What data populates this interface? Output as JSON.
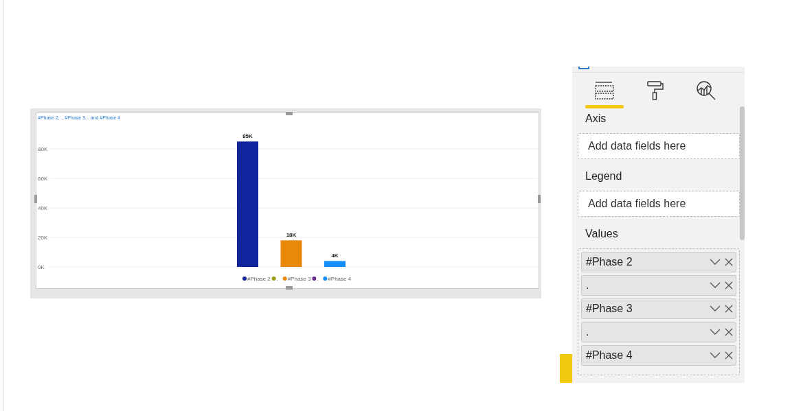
{
  "chart": {
    "chart_data": {
      "type": "bar",
      "title": "#Phase 2, ., #Phase 3, . and #Phase 4",
      "series": [
        {
          "name": "#Phase 2",
          "color": "#12239e",
          "values": [
            85000
          ]
        },
        {
          "name": ".",
          "color": "#9c9c12",
          "values": [
            null
          ]
        },
        {
          "name": "#Phase 3",
          "color": "#e8890c",
          "values": [
            18000
          ]
        },
        {
          "name": ".",
          "color": "#6b2d8f",
          "values": [
            null
          ]
        },
        {
          "name": "#Phase 4",
          "color": "#118dff",
          "values": [
            4000
          ]
        }
      ],
      "yticks": [
        {
          "value": 0,
          "label": "0K"
        },
        {
          "value": 20000,
          "label": "20K"
        },
        {
          "value": 40000,
          "label": "40K"
        },
        {
          "value": 60000,
          "label": "60K"
        },
        {
          "value": 80000,
          "label": "80K"
        }
      ],
      "ylim": [
        0,
        85000
      ],
      "grid": true,
      "legend": true,
      "value_labels": [
        "85K",
        null,
        "18K",
        null,
        "4K"
      ]
    }
  },
  "panel": {
    "tabs": [
      {
        "kind": "fields",
        "selected": true
      },
      {
        "kind": "format",
        "selected": false
      },
      {
        "kind": "analytics",
        "selected": false
      }
    ],
    "wells": [
      {
        "label": "Axis",
        "placeholder": "Add data fields here"
      },
      {
        "label": "Legend",
        "placeholder": "Add data fields here"
      },
      {
        "label": "Values",
        "fields": [
          {
            "name": "#Phase 2"
          },
          {
            "name": "."
          },
          {
            "name": "#Phase 3"
          },
          {
            "name": "."
          },
          {
            "name": "#Phase 4"
          }
        ]
      }
    ]
  }
}
